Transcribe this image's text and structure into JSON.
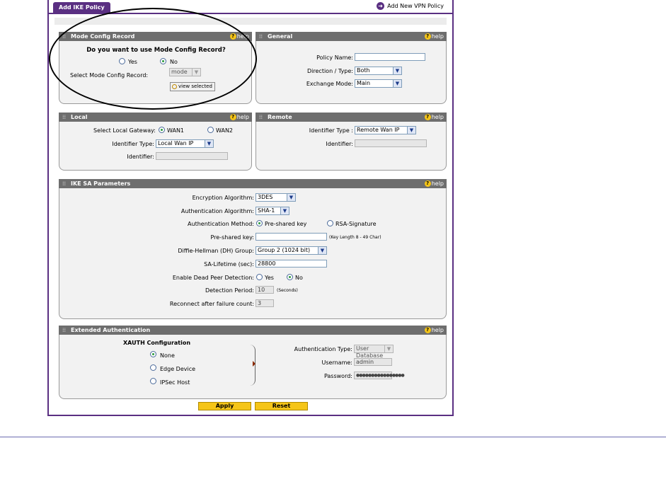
{
  "header": {
    "tab_label": "Add IKE Policy",
    "add_link": "Add New VPN Policy"
  },
  "help_label": "help",
  "mode_config": {
    "title": "Mode Config Record",
    "question": "Do you want to use Mode Config Record?",
    "yes": "Yes",
    "no": "No",
    "selected": "No",
    "select_label": "Select Mode Config Record:",
    "select_value": "mode",
    "view_button": "view selected"
  },
  "general": {
    "title": "General",
    "policy_name_label": "Policy Name:",
    "policy_name_value": "",
    "direction_label": "Direction / Type:",
    "direction_value": "Both",
    "exchange_label": "Exchange Mode:",
    "exchange_value": "Main"
  },
  "local": {
    "title": "Local",
    "gateway_label": "Select Local Gateway:",
    "wan1": "WAN1",
    "wan2": "WAN2",
    "selected": "WAN1",
    "id_type_label": "Identifier Type:",
    "id_type_value": "Local Wan IP",
    "identifier_label": "Identifier:",
    "identifier_value": ""
  },
  "remote": {
    "title": "Remote",
    "id_type_label": "Identifier Type :",
    "id_type_value": "Remote Wan IP",
    "identifier_label": "Identifier:",
    "identifier_value": ""
  },
  "ike_sa": {
    "title": "IKE SA Parameters",
    "enc_label": "Encryption Algorithm:",
    "enc_value": "3DES",
    "auth_alg_label": "Authentication Algorithm:",
    "auth_alg_value": "SHA-1",
    "auth_method_label": "Authentication Method:",
    "psk_option": "Pre-shared key",
    "rsa_option": "RSA-Signature",
    "auth_method_selected": "Pre-shared key",
    "psk_label": "Pre-shared key:",
    "psk_value": "",
    "psk_hint": "(Key Length 8 - 49 Char)",
    "dh_label": "Diffie-Hellman (DH) Group:",
    "dh_value": "Group 2 (1024 bit)",
    "lifetime_label": "SA-Lifetime (sec):",
    "lifetime_value": "28800",
    "dpd_label": "Enable Dead Peer Detection:",
    "dpd_yes": "Yes",
    "dpd_no": "No",
    "dpd_selected": "No",
    "period_label": "Detection Period:",
    "period_value": "10",
    "period_unit": "(Seconds)",
    "reconnect_label": "Reconnect after failure count:",
    "reconnect_value": "3"
  },
  "xauth": {
    "title": "Extended Authentication",
    "config_title": "XAUTH Configuration",
    "none": "None",
    "edge": "Edge Device",
    "ipsec": "IPSec Host",
    "selected": "None",
    "auth_type_label": "Authentication Type:",
    "auth_type_value": "User Database",
    "username_label": "Username:",
    "username_value": "admin",
    "password_label": "Password:",
    "password_value": "●●●●●●●●●●●●●●●●"
  },
  "buttons": {
    "apply": "Apply",
    "reset": "Reset"
  },
  "colors": {
    "accent": "#5a2f82",
    "section_header": "#6e6e6e",
    "button": "#f5c518"
  }
}
